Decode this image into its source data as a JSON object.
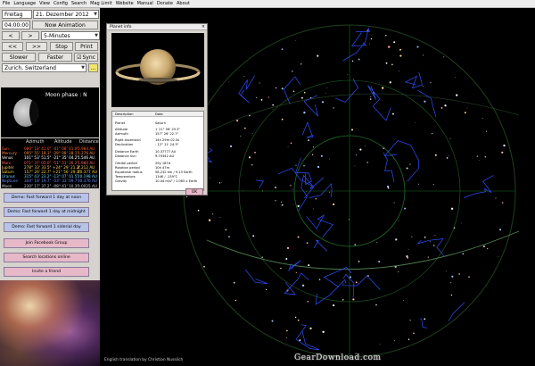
{
  "menu": [
    "File",
    "Language",
    "View",
    "Config",
    "Search",
    "Mag Limit",
    "Website",
    "Manual",
    "Donate",
    "About"
  ],
  "date": {
    "weekday": "Freitag",
    "day_month_year": "21. Dezember 2012"
  },
  "time": {
    "value": "04:00:00",
    "now_animation": "Now Animation"
  },
  "step": {
    "back": "<",
    "forward": ">",
    "interval": "5-Minutes"
  },
  "anim": {
    "fast_back": "<<",
    "fast_forward": ">>",
    "stop": "Stop",
    "print": "Print"
  },
  "speed": {
    "slower": "Slower",
    "faster": "Faster",
    "sync": "Sync"
  },
  "location": {
    "value": "Zurich, Switzerland",
    "more": "..."
  },
  "moon": {
    "phase_label": "Moon phase : N"
  },
  "planet_table": {
    "headers": [
      "Azimuth",
      "Altitude",
      "Distance"
    ],
    "rows": [
      {
        "name": "Sun",
        "color": "#ff5a2a",
        "az": "080° 18' 41.0\"",
        "alt": "-41° 08' 01.0\"",
        "dist": "0.984 AU"
      },
      {
        "name": "Mercury",
        "color": "#ff8c3a",
        "az": "095° 55' 18.3\"",
        "alt": "-29° 08' 28.1\"",
        "dist": "1.276 AU"
      },
      {
        "name": "Venus",
        "color": "#ffffff",
        "az": "101° 53' 51.5\"",
        "alt": "-21° 35' 04.2\"",
        "dist": "1.546 AU"
      },
      {
        "name": "Mars",
        "color": "#ff6060",
        "az": "071° 37' 05.0\"",
        "alt": "-51° 51' 26.2\"",
        "dist": "1.980 AU"
      },
      {
        "name": "Jupiter",
        "color": "#ffd070",
        "az": "278° 33' 33.5\"",
        "alt": "+24° 29' 21.2\"",
        "dist": "4.212 AU"
      },
      {
        "name": "Saturn",
        "color": "#ffd040",
        "az": "157° 26' 22.7\"",
        "alt": "+21° 56' 29.3\"",
        "dist": "10.377 AU"
      },
      {
        "name": "Uranus",
        "color": "#6fd4ff",
        "az": "315° 43' 23.2\"",
        "alt": "-13° 07' 01.5\"",
        "dist": "20.198 AU"
      },
      {
        "name": "Neptune",
        "color": "#6f8cff",
        "az": "344° 18' 19.7\"",
        "alt": "-53° 33' 09.7\"",
        "dist": "30.376 AU"
      },
      {
        "name": "Moon",
        "color": "#cfcfcf",
        "az": "230° 17' 37.2\"",
        "alt": "-08° 41' 10.3\"",
        "dist": "0.0025 AU"
      }
    ]
  },
  "demos": {
    "noon": "Demo: Fast forward 1 day at noon",
    "midnight": "Demo: Fast forward 1 day at midnight",
    "sidereal": "Demo: Fast forward 1 siderial day",
    "facebook": "Join Facebook Group",
    "search": "Search locations online",
    "invite": "Invite a friend"
  },
  "dialog": {
    "title": "Planet info",
    "close": "×",
    "table_headers": [
      "Description",
      "Data"
    ],
    "rows": [
      {
        "label": "Planet",
        "value": "Saturn"
      },
      {
        "label": "Altitude",
        "value": "+ 21° 56' 29.3\""
      },
      {
        "label": "Azimuth",
        "value": "157° 26' 22.7\""
      },
      {
        "label": "Right Ascension",
        "value": "14h 29m 02.3s"
      },
      {
        "label": "Declination",
        "value": "- 12° 11' 24.3\""
      },
      {
        "label": "Distance Earth",
        "value": "10.37777 AU"
      },
      {
        "label": "Distance Sun",
        "value": "9.70342 AU"
      },
      {
        "label": "Orbital period",
        "value": "29y 167d"
      },
      {
        "label": "Rotation period",
        "value": "10h 47m"
      },
      {
        "label": "Equatorial radius",
        "value": "58,232 km / 9.13 Earth"
      },
      {
        "label": "Temperature",
        "value": "134K / -139°C"
      },
      {
        "label": "Gravity",
        "value": "10.44 m/s² / 1.065 x Earth"
      }
    ],
    "ok": "OK"
  },
  "credit": "English translation by Christian Nusslich",
  "watermark": "GearDownload.com",
  "colors": {
    "constellation_lines": "#2f4fff",
    "grid": "#1f6b2a",
    "ecliptic": "#5a8a5a",
    "panel_bg": "#d6d3ce"
  }
}
